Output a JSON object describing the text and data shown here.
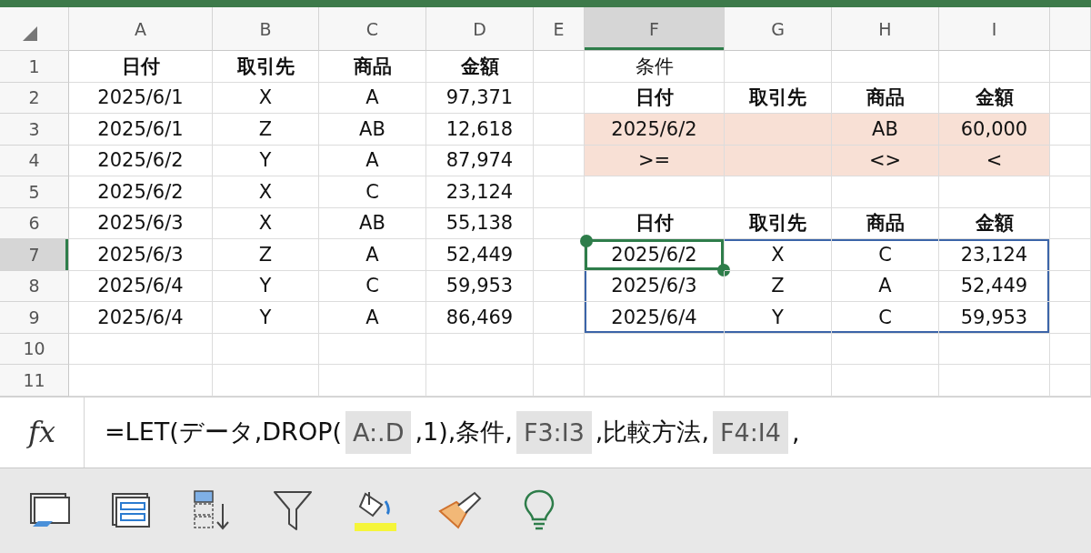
{
  "columns": [
    {
      "label": "A",
      "selected": false
    },
    {
      "label": "B",
      "selected": false
    },
    {
      "label": "C",
      "selected": false
    },
    {
      "label": "D",
      "selected": false
    },
    {
      "label": "E",
      "selected": false
    },
    {
      "label": "F",
      "selected": true
    },
    {
      "label": "G",
      "selected": false
    },
    {
      "label": "H",
      "selected": false
    },
    {
      "label": "I",
      "selected": false
    }
  ],
  "rows": [
    {
      "label": "1",
      "selected": false,
      "cells": [
        {
          "text": "日付",
          "bold": true
        },
        {
          "text": "取引先",
          "bold": true
        },
        {
          "text": "商品",
          "bold": true
        },
        {
          "text": "金額",
          "bold": true
        },
        {},
        {
          "text": "条件"
        },
        {},
        {},
        {}
      ]
    },
    {
      "label": "2",
      "selected": false,
      "cells": [
        {
          "text": "2025/6/1"
        },
        {
          "text": "X"
        },
        {
          "text": "A"
        },
        {
          "text": "97,371"
        },
        {},
        {
          "text": "日付",
          "bold": true
        },
        {
          "text": "取引先",
          "bold": true
        },
        {
          "text": "商品",
          "bold": true
        },
        {
          "text": "金額",
          "bold": true
        }
      ]
    },
    {
      "label": "3",
      "selected": false,
      "cells": [
        {
          "text": "2025/6/1"
        },
        {
          "text": "Z"
        },
        {
          "text": "AB"
        },
        {
          "text": "12,618"
        },
        {},
        {
          "text": "2025/6/2",
          "shaded": true
        },
        {
          "shaded": true
        },
        {
          "text": "AB",
          "shaded": true
        },
        {
          "text": "60,000",
          "shaded": true
        }
      ]
    },
    {
      "label": "4",
      "selected": false,
      "cells": [
        {
          "text": "2025/6/2"
        },
        {
          "text": "Y"
        },
        {
          "text": "A"
        },
        {
          "text": "87,974"
        },
        {},
        {
          "text": ">=",
          "shaded": true
        },
        {
          "shaded": true
        },
        {
          "text": "<>",
          "shaded": true
        },
        {
          "text": "<",
          "shaded": true
        }
      ]
    },
    {
      "label": "5",
      "selected": false,
      "cells": [
        {
          "text": "2025/6/2"
        },
        {
          "text": "X"
        },
        {
          "text": "C"
        },
        {
          "text": "23,124"
        },
        {},
        {},
        {},
        {},
        {}
      ]
    },
    {
      "label": "6",
      "selected": false,
      "cells": [
        {
          "text": "2025/6/3"
        },
        {
          "text": "X"
        },
        {
          "text": "AB"
        },
        {
          "text": "55,138"
        },
        {},
        {
          "text": "日付",
          "bold": true
        },
        {
          "text": "取引先",
          "bold": true
        },
        {
          "text": "商品",
          "bold": true
        },
        {
          "text": "金額",
          "bold": true
        }
      ]
    },
    {
      "label": "7",
      "selected": true,
      "cells": [
        {
          "text": "2025/6/3"
        },
        {
          "text": "Z"
        },
        {
          "text": "A"
        },
        {
          "text": "52,449"
        },
        {},
        {
          "text": "2025/6/2",
          "spill": true,
          "active": true
        },
        {
          "text": "X",
          "spill": true
        },
        {
          "text": "C",
          "spill": true
        },
        {
          "text": "23,124",
          "spill": true
        }
      ]
    },
    {
      "label": "8",
      "selected": false,
      "cells": [
        {
          "text": "2025/6/4"
        },
        {
          "text": "Y"
        },
        {
          "text": "C"
        },
        {
          "text": "59,953"
        },
        {},
        {
          "text": "2025/6/3",
          "spill": true
        },
        {
          "text": "Z",
          "spill": true
        },
        {
          "text": "A",
          "spill": true
        },
        {
          "text": "52,449",
          "spill": true
        }
      ]
    },
    {
      "label": "9",
      "selected": false,
      "cells": [
        {
          "text": "2025/6/4"
        },
        {
          "text": "Y"
        },
        {
          "text": "A"
        },
        {
          "text": "86,469"
        },
        {},
        {
          "text": "2025/6/4",
          "spill": true
        },
        {
          "text": "Y",
          "spill": true
        },
        {
          "text": "C",
          "spill": true
        },
        {
          "text": "59,953",
          "spill": true
        }
      ]
    },
    {
      "label": "10",
      "selected": false,
      "cells": [
        {},
        {},
        {},
        {},
        {},
        {},
        {},
        {},
        {}
      ]
    },
    {
      "label": "11",
      "selected": false,
      "cells": [
        {},
        {},
        {},
        {},
        {},
        {},
        {},
        {},
        {}
      ]
    }
  ],
  "formula_bar": {
    "fx_label": "fx",
    "parts": [
      {
        "kind": "text",
        "text": "=LET(データ,DROP("
      },
      {
        "kind": "ref",
        "text": "A:.D"
      },
      {
        "kind": "text",
        "text": ",1),条件,"
      },
      {
        "kind": "ref",
        "text": "F3:I3"
      },
      {
        "kind": "text",
        "text": ",比較方法,"
      },
      {
        "kind": "ref",
        "text": "F4:I4"
      },
      {
        "kind": "text",
        "text": ","
      }
    ]
  }
}
